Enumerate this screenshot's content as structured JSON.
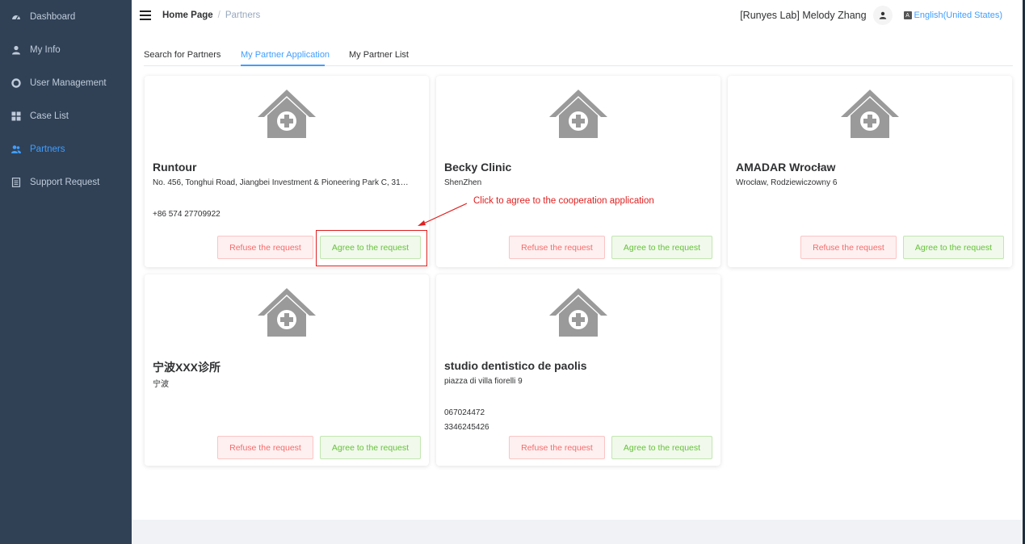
{
  "sidebar": {
    "items": [
      {
        "label": "Dashboard",
        "icon": "dashboard-icon"
      },
      {
        "label": "My Info",
        "icon": "user-icon"
      },
      {
        "label": "User Management",
        "icon": "lifebuoy-icon"
      },
      {
        "label": "Case List",
        "icon": "grid-icon"
      },
      {
        "label": "Partners",
        "icon": "partners-icon",
        "active": true
      },
      {
        "label": "Support Request",
        "icon": "document-icon"
      }
    ]
  },
  "header": {
    "breadcrumb_home": "Home Page",
    "breadcrumb_sep": "/",
    "breadcrumb_current": "Partners",
    "username": "[Runyes Lab] Melody Zhang",
    "language": "English(United States)"
  },
  "tabs": [
    {
      "label": "Search for Partners",
      "active": false
    },
    {
      "label": "My Partner Application",
      "active": true
    },
    {
      "label": "My Partner List",
      "active": false
    }
  ],
  "cards": [
    {
      "name": "Runtour",
      "address": "No. 456, Tonghui Road, Jiangbei Investment & Pioneering Park C, 31…",
      "phone1": "+86 574 27709922",
      "phone2": "",
      "refuse_label": "Refuse the request",
      "agree_label": "Agree to the request"
    },
    {
      "name": "Becky Clinic",
      "address": "ShenZhen",
      "phone1": "",
      "phone2": "",
      "refuse_label": "Refuse the request",
      "agree_label": "Agree to the request"
    },
    {
      "name": "AMADAR Wrocław",
      "address": "Wrocław, Rodziewiczowny 6",
      "phone1": "",
      "phone2": "",
      "refuse_label": "Refuse the request",
      "agree_label": "Agree to the request"
    },
    {
      "name": "宁波XXX诊所",
      "address": "宁波",
      "phone1": "",
      "phone2": "",
      "refuse_label": "Refuse the request",
      "agree_label": "Agree to the request"
    },
    {
      "name": "studio dentistico de paolis",
      "address": "piazza di villa fiorelli 9",
      "phone1": "067024472",
      "phone2": "3346245426",
      "refuse_label": "Refuse the request",
      "agree_label": "Agree to the request"
    }
  ],
  "annotation": {
    "text": "Click to agree to the cooperation application"
  },
  "colors": {
    "sidebar_bg": "#304156",
    "accent": "#409eff",
    "refuse": "#f56c6c",
    "agree": "#67c23a",
    "annotation": "#e02020",
    "house_icon": "#9a9a9a"
  }
}
